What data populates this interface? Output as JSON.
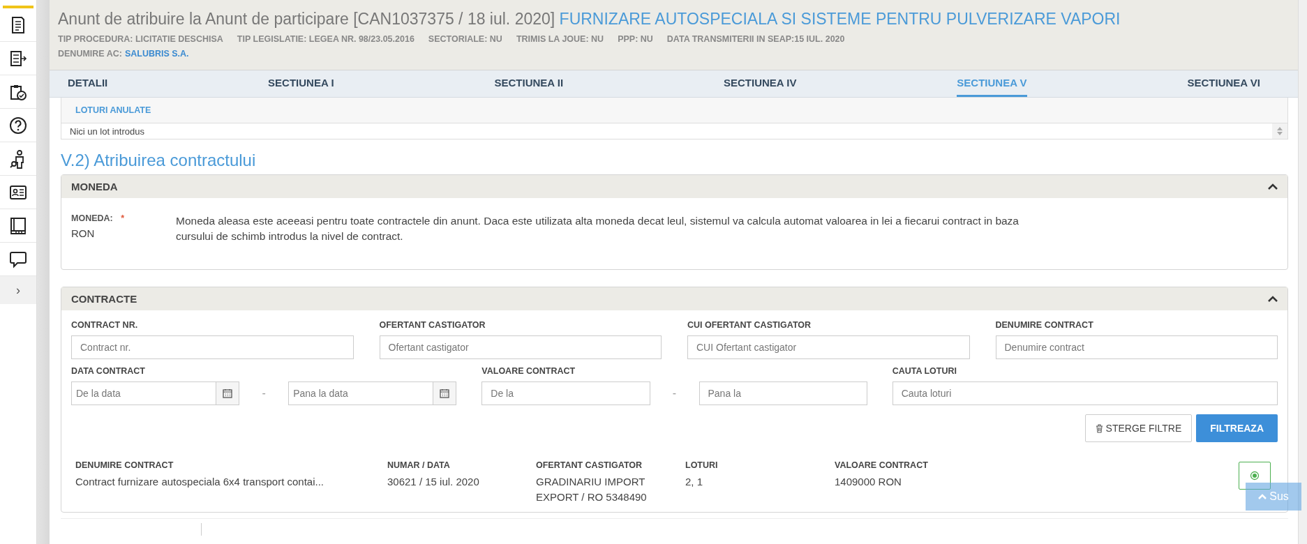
{
  "sidebar": {
    "expand_glyph": "›"
  },
  "header": {
    "title": "Anunt de atribuire la Anunt de participare [CAN1037375 / 18 iul. 2020]",
    "title_link": "FURNIZARE AUTOSPECIALA SI SISTEME PENTRU PULVERIZARE VAPORI",
    "meta": [
      "TIP PROCEDURA: LICITATIE DESCHISA",
      "TIP LEGISLATIE: LEGEA NR. 98/23.05.2016",
      "SECTORIALE: NU",
      "TRIMIS LA JOUE: NU",
      "PPP: NU",
      "DATA TRANSMITERII IN SEAP:15 IUL. 2020"
    ],
    "authority_label": "DENUMIRE AC:",
    "authority_link": "SALUBRIS S.A."
  },
  "tabs": [
    {
      "label": "DETALII",
      "selected": false
    },
    {
      "label": "SECTIUNEA I",
      "selected": false
    },
    {
      "label": "SECTIUNEA II",
      "selected": false
    },
    {
      "label": "SECTIUNEA IV",
      "selected": false
    },
    {
      "label": "SECTIUNEA V",
      "selected": true
    },
    {
      "label": "SECTIUNEA VI",
      "selected": false
    }
  ],
  "loturi_anulate": {
    "title": "LOTURI ANULATE",
    "empty_text": "Nici un lot introdus"
  },
  "section_title": "V.2) Atribuirea contractului",
  "moneda": {
    "title": "MONEDA",
    "expanded": true,
    "field_label": "MONEDA:",
    "required": true,
    "required_mark": "*",
    "value": "RON",
    "note": "Moneda aleasa este aceeasi pentru toate contractele din anunt. Daca este utilizata alta moneda decat leul, sistemul va calcula automat valoarea in lei a fiecarui contract in baza cursului de schimb introdus la nivel de contract."
  },
  "contracte": {
    "title": "CONTRACTE",
    "expanded": true,
    "filters_row_1": [
      {
        "label": "CONTRACT NR.",
        "placeholder": "Contract nr."
      },
      {
        "label": "OFERTANT CASTIGATOR",
        "placeholder": "Ofertant castigator"
      },
      {
        "label": "CUI OFERTANT CASTIGATOR",
        "placeholder": "CUI Ofertant castigator"
      },
      {
        "label": "DENUMIRE CONTRACT",
        "placeholder": "Denumire contract"
      }
    ],
    "filters_row_2": [
      {
        "kind": "date_range",
        "label": "DATA CONTRACT",
        "from_placeholder": "De la data",
        "separator": "-",
        "to_placeholder": "Pana la data"
      },
      {
        "kind": "range",
        "label": "VALOARE CONTRACT",
        "from_placeholder": "De la",
        "separator": "-",
        "to_placeholder": "Pana la"
      },
      {
        "kind": "text",
        "label": "CAUTA LOTURI",
        "placeholder": "Cauta loturi"
      }
    ],
    "clear_button": "STERGE FILTRE",
    "filter_button": "FILTREAZA",
    "columns": [
      "DENUMIRE CONTRACT",
      "NUMAR / DATA",
      "OFERTANT CASTIGATOR",
      "LOTURI",
      "VALOARE CONTRACT"
    ],
    "rows": [
      [
        "Contract furnizare autospeciala 6x4 transport contai...",
        "30621 / 15 iul. 2020",
        "GRADINARIU IMPORT EXPORT / RO 5348490",
        "2, 1",
        "1409000 RON"
      ]
    ]
  },
  "back_to_top": "Sus"
}
